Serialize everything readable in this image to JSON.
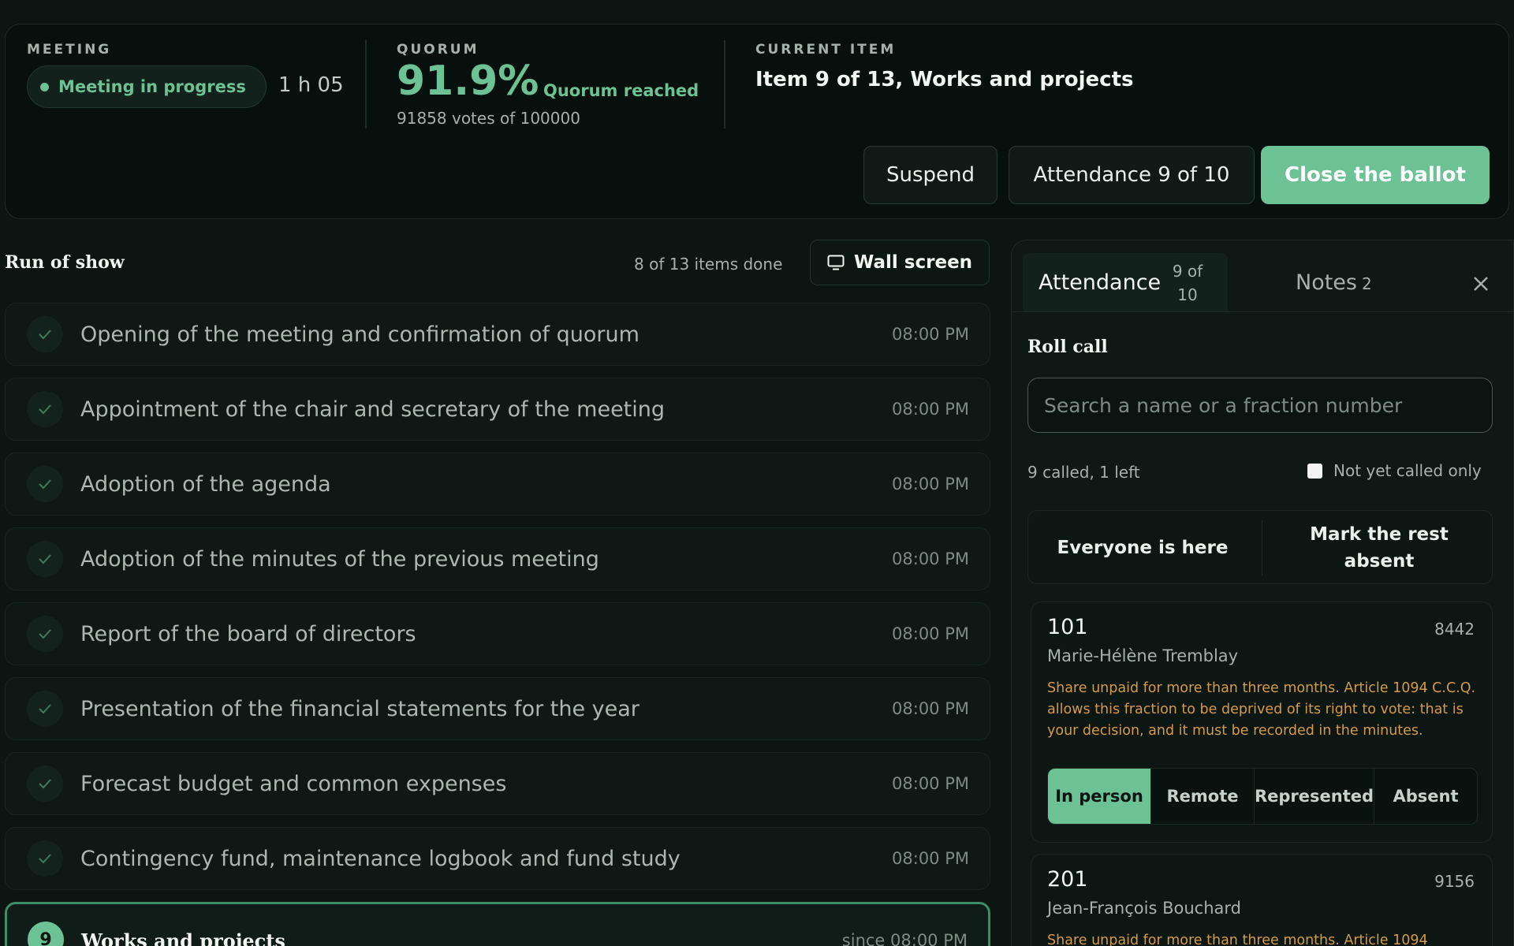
{
  "meeting": {
    "label": "MEETING",
    "status": "Meeting in progress",
    "elapsed": "1 h 05"
  },
  "quorum": {
    "label": "QUORUM",
    "percent": "91.9%",
    "status": "Quorum reached",
    "votes": "91858 votes of 100000"
  },
  "current": {
    "label": "CURRENT ITEM",
    "title": "Item 9 of 13, Works and projects"
  },
  "actions": {
    "suspend": "Suspend",
    "attendance": "Attendance 9 of 10",
    "close_ballot": "Close the ballot"
  },
  "run_of_show": {
    "title": "Run of show",
    "progress": "8 of 13 items done",
    "wall_screen": "Wall screen",
    "items": [
      {
        "title": "Opening of the meeting and confirmation of quorum",
        "time": "08:00 PM"
      },
      {
        "title": "Appointment of the chair and secretary of the meeting",
        "time": "08:00 PM"
      },
      {
        "title": "Adoption of the agenda",
        "time": "08:00 PM"
      },
      {
        "title": "Adoption of the minutes of the previous meeting",
        "time": "08:00 PM"
      },
      {
        "title": "Report of the board of directors",
        "time": "08:00 PM"
      },
      {
        "title": "Presentation of the financial statements for the year",
        "time": "08:00 PM"
      },
      {
        "title": "Forecast budget and common expenses",
        "time": "08:00 PM"
      },
      {
        "title": "Contingency fund, maintenance logbook and fund study",
        "time": "08:00 PM"
      }
    ],
    "active": {
      "number": "9",
      "title": "Works and projects",
      "time": "since 08:00 PM"
    }
  },
  "panel": {
    "tab_attendance": "Attendance",
    "tab_attendance_count": "9 of 10",
    "tab_notes": "Notes",
    "tab_notes_count": "2",
    "rollcall_title": "Roll call",
    "search_placeholder": "Search a name or a fraction number",
    "called_summary": "9 called, 1 left",
    "filter_label": "Not yet called only",
    "everyone_here": "Everyone is here",
    "mark_rest_absent": "Mark the rest absent",
    "modes": [
      "In person",
      "Remote",
      "Represented",
      "Absent"
    ],
    "cards": [
      {
        "unit": "101",
        "shares": "8442",
        "owner": "Marie-Hélène Tremblay",
        "warning": "Share unpaid for more than three months. Article 1094 C.C.Q. allows this fraction to be deprived of its right to vote: that is your decision, and it must be recorded in the minutes."
      },
      {
        "unit": "201",
        "shares": "9156",
        "owner": "Jean-François Bouchard",
        "warning": "Share unpaid for more than three months. Article 1094"
      }
    ]
  },
  "colors": {
    "accent": "#6cc195",
    "warning": "#d69a4a",
    "background": "#0c1512"
  }
}
